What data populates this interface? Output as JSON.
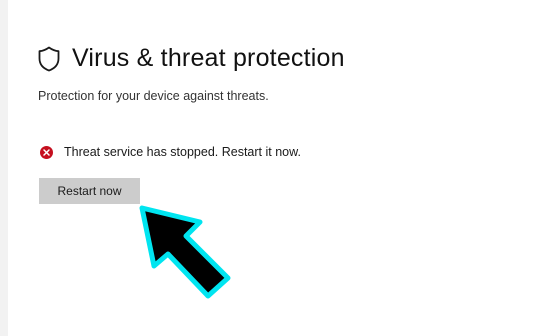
{
  "header": {
    "title": "Virus & threat protection",
    "icon": "shield-icon"
  },
  "subtitle": "Protection for your device against threats.",
  "alert": {
    "icon": "error-icon",
    "text": "Threat service has stopped. Restart it now.",
    "color": "#c50f1f"
  },
  "actions": {
    "restart_label": "Restart now"
  },
  "annotation": {
    "icon": "pointer-arrow-icon",
    "outline_color": "#00e5f0",
    "fill_color": "#000000"
  }
}
